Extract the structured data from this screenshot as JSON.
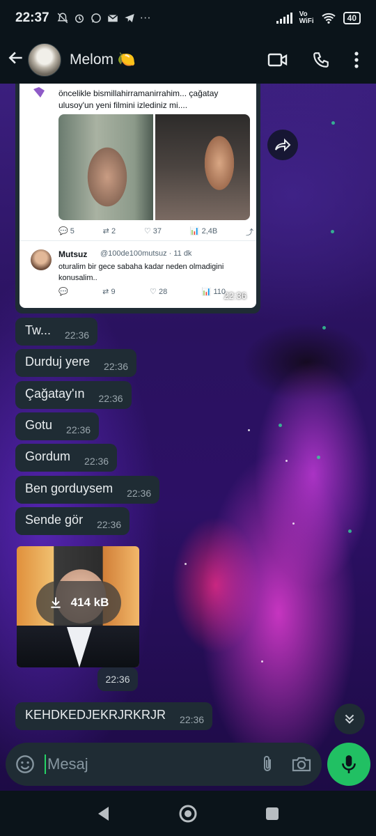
{
  "status_bar": {
    "time": "22:37",
    "volte": "Vo",
    "wifi_label": "WiFi",
    "battery": "40"
  },
  "header": {
    "contact_name": "Melom 🍋"
  },
  "shared_tweet": {
    "text": "öncelikle bismillahirramanirrahim... çağatay ulusoy'un yeni filmini izlediniz mi....",
    "stats": [
      "5",
      "2",
      "37",
      "2,4B"
    ],
    "reply_name": "Mutsuz",
    "reply_handle": "@100de100mutsuz · 11 dk",
    "reply_text": "oturalim bir gece sabaha kadar neden olmadigini konusalim..",
    "reply_stats": [
      "",
      "9",
      "28",
      "110"
    ],
    "time": "22:36"
  },
  "messages": [
    {
      "text": "Tw...",
      "time": "22:36"
    },
    {
      "text": "Durduj yere",
      "time": "22:36"
    },
    {
      "text": "Çağatay'ın",
      "time": "22:36"
    },
    {
      "text": "Gotu",
      "time": "22:36"
    },
    {
      "text": "Gordum",
      "time": "22:36"
    },
    {
      "text": "Ben gorduysem",
      "time": "22:36"
    },
    {
      "text": "Sende gör",
      "time": "22:36"
    }
  ],
  "media": {
    "size": "414 kB",
    "time": "22:36"
  },
  "last_message": {
    "text": "KEHDKEDJEKRJRKRJR",
    "time": "22:36"
  },
  "composer": {
    "placeholder": "Mesaj"
  },
  "colors": {
    "bubble": "#1f2c34",
    "header": "#0b141a",
    "accent": "#21c063"
  }
}
